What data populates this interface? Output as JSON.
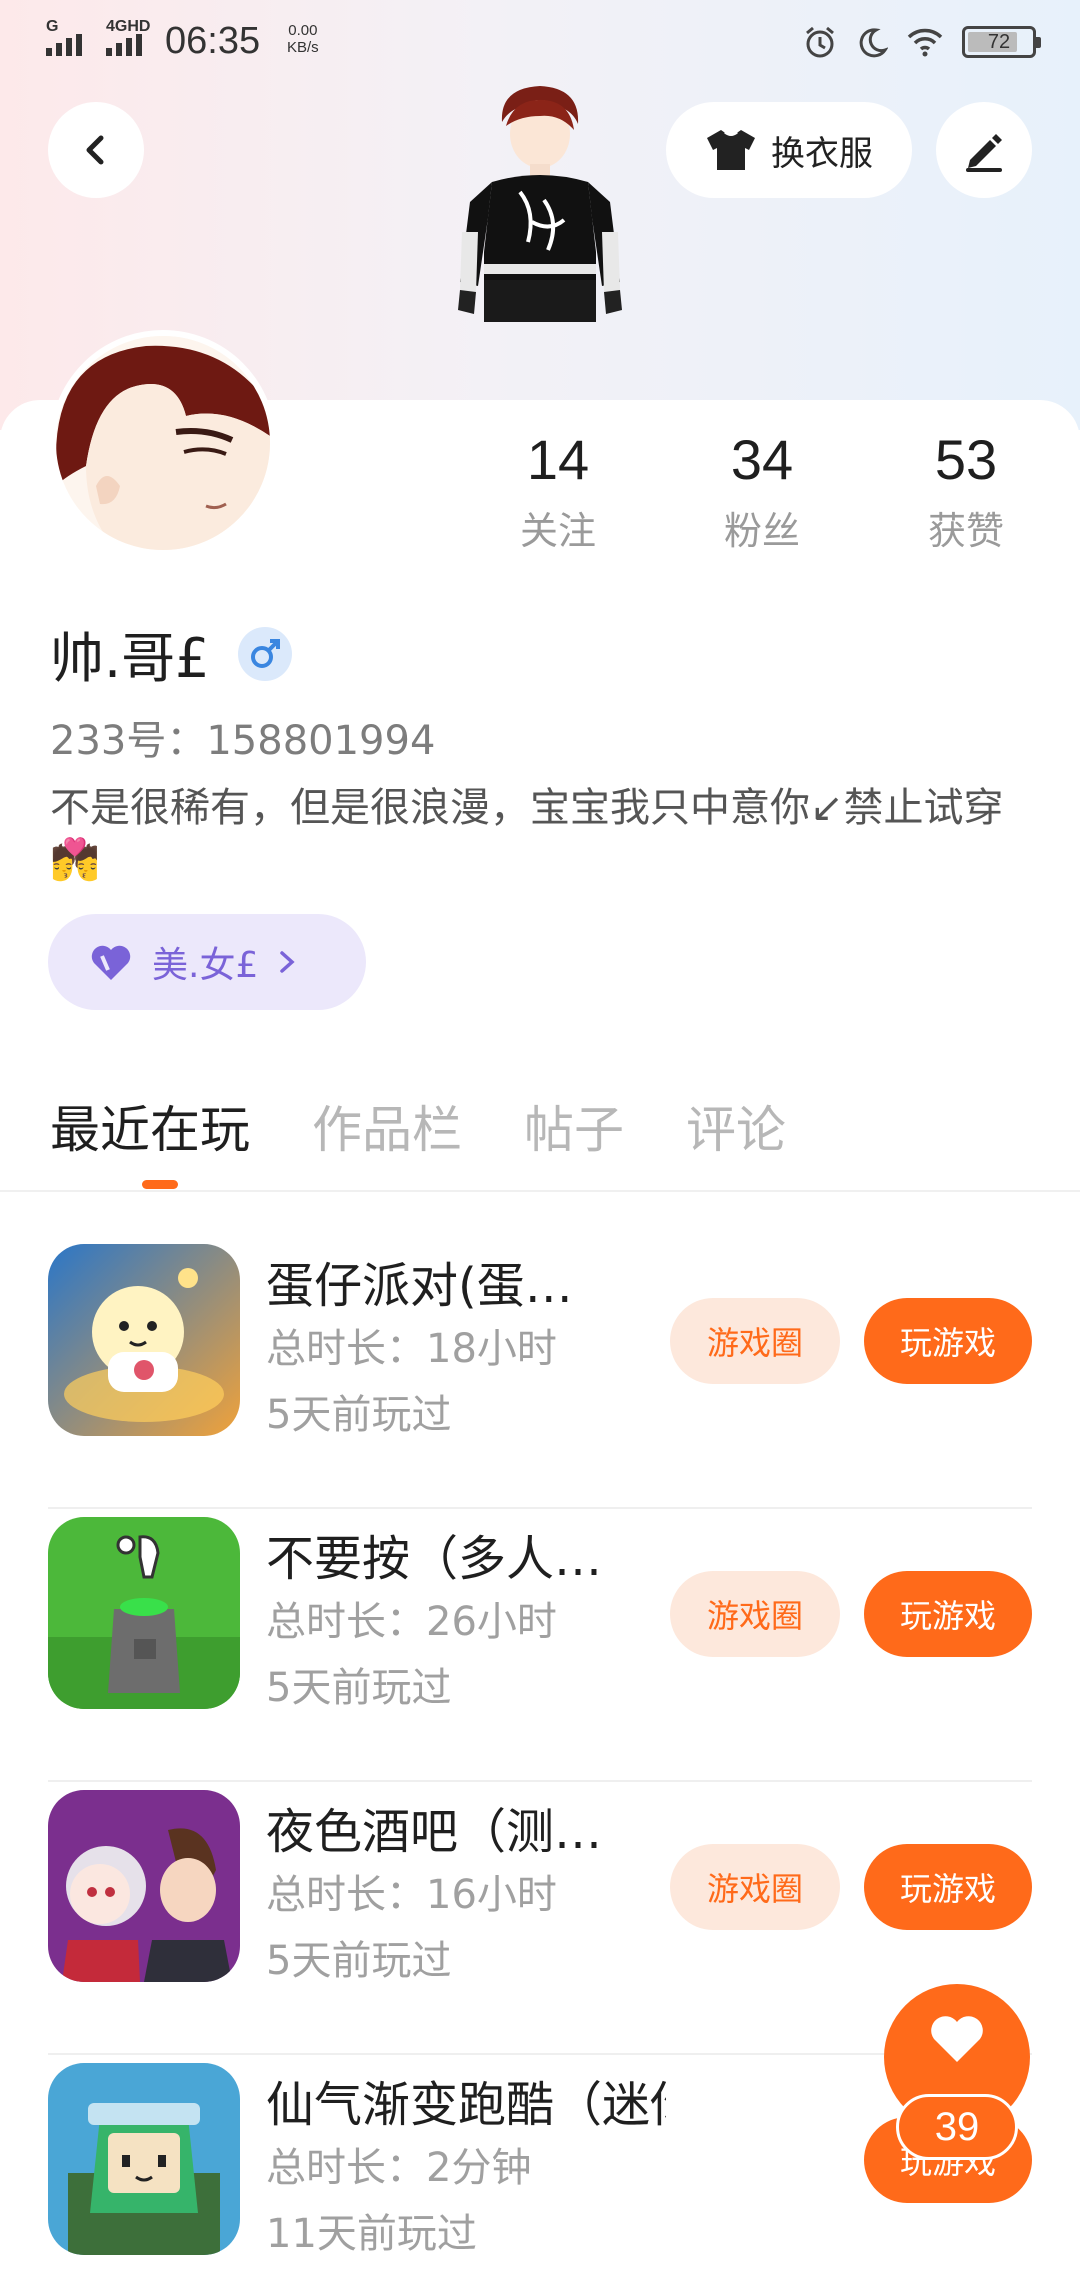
{
  "status_bar": {
    "sim1_label": "G",
    "sim2_label": "4GHD",
    "time": "06:35",
    "rate_value": "0.00",
    "rate_unit": "KB/s",
    "battery": "72",
    "icons": [
      "alarm-icon",
      "moon-icon",
      "wifi-icon",
      "battery-icon"
    ]
  },
  "header": {
    "back_icon": "chevron-left-icon",
    "dress_label": "换衣服",
    "dress_icon": "tshirt-icon",
    "edit_icon": "pencil-icon"
  },
  "stats": [
    {
      "value": "14",
      "label": "关注"
    },
    {
      "value": "34",
      "label": "粉丝"
    },
    {
      "value": "53",
      "label": "获赞"
    }
  ],
  "profile": {
    "nickname": "帅.哥£",
    "gender_icon": "male-icon",
    "uid": "233号：158801994",
    "bio": "不是很稀有，但是很浪漫，宝宝我只中意你↙禁止试穿💏",
    "couple_name": "美.女£",
    "couple_icon": "heart-icon"
  },
  "tabs": [
    "最近在玩",
    "作品栏",
    "帖子",
    "评论"
  ],
  "active_tab": "最近在玩",
  "games": [
    {
      "name": "蛋仔派对(蛋…",
      "duration": "总时长：18小时",
      "last_played": "5天前玩过",
      "circle_label": "游戏圈",
      "play_label": "玩游戏"
    },
    {
      "name": "不要按（多人…",
      "duration": "总时长：26小时",
      "last_played": "5天前玩过",
      "circle_label": "游戏圈",
      "play_label": "玩游戏"
    },
    {
      "name": "夜色酒吧（测…",
      "duration": "总时长：16小时",
      "last_played": "5天前玩过",
      "circle_label": "游戏圈",
      "play_label": "玩游戏"
    },
    {
      "name": "仙气渐变跑酷（迷你…",
      "duration": "总时长：2分钟",
      "last_played": "11天前玩过",
      "circle_label": "",
      "play_label": "玩游戏"
    }
  ],
  "like_fab": {
    "count": "39",
    "icon": "heart-icon"
  },
  "colors": {
    "accent": "#ff6a1a",
    "accent_light": "#fde8dc",
    "couple": "#7a63d8"
  }
}
